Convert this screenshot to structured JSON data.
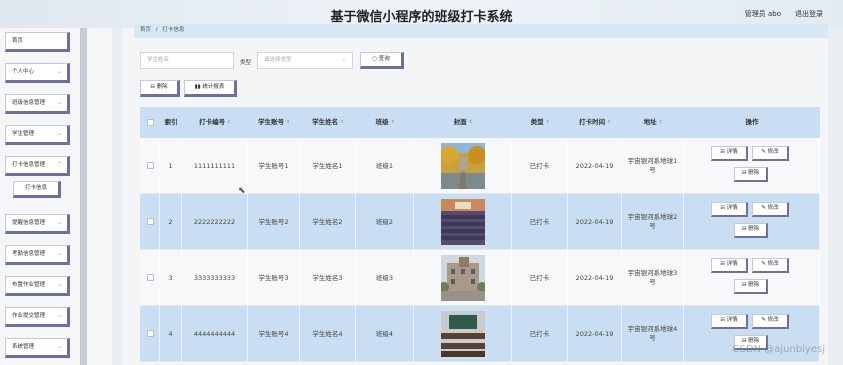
{
  "header": {
    "title": "基于微信小程序的班级打卡系统",
    "user": "管理员 abo",
    "logout": "退出登录"
  },
  "sidebar": {
    "items": [
      {
        "label": "首页",
        "has_chevron": false
      },
      {
        "label": "个人中心",
        "has_chevron": true
      },
      {
        "label": "班级信息管理",
        "has_chevron": true
      },
      {
        "label": "学生管理",
        "has_chevron": true
      },
      {
        "label": "打卡信息管理",
        "has_chevron": true
      },
      {
        "label": "打卡信息",
        "has_chevron": false,
        "sub": true
      },
      {
        "label": "提醒信息管理",
        "has_chevron": true
      },
      {
        "label": "考勤信息管理",
        "has_chevron": true
      },
      {
        "label": "布置作业管理",
        "has_chevron": true
      },
      {
        "label": "作业提交管理",
        "has_chevron": true
      },
      {
        "label": "系统管理",
        "has_chevron": true
      }
    ]
  },
  "breadcrumb": {
    "home": "首页",
    "separator": "/",
    "current": "打卡信息"
  },
  "search": {
    "placeholder": "学生姓名",
    "type_label": "类型",
    "type_placeholder": "请选择类型",
    "search_button": "查询",
    "delete_button": "删除",
    "stats_button": "统计报表"
  },
  "table": {
    "headers": [
      "",
      "索引",
      "打卡编号",
      "学生账号",
      "学生姓名",
      "班级",
      "封面",
      "类型",
      "打卡时间",
      "地址",
      "操作"
    ],
    "rows": [
      {
        "index": "1",
        "number": "1111111111",
        "account": "学生账号1",
        "name": "学生姓名1",
        "class": "班级1",
        "type": "已打卡",
        "time": "2022-04-19",
        "address": "宇宙银河系地球1号"
      },
      {
        "index": "2",
        "number": "2222222222",
        "account": "学生账号2",
        "name": "学生姓名2",
        "class": "班级2",
        "type": "已打卡",
        "time": "2022-04-19",
        "address": "宇宙银河系地球2号"
      },
      {
        "index": "3",
        "number": "3333333333",
        "account": "学生账号3",
        "name": "学生姓名3",
        "class": "班级3",
        "type": "已打卡",
        "time": "2022-04-19",
        "address": "宇宙银河系地球3号"
      },
      {
        "index": "4",
        "number": "4444444444",
        "account": "学生账号4",
        "name": "学生姓名4",
        "class": "班级4",
        "type": "已打卡",
        "time": "2022-04-19",
        "address": "宇宙银河系地球4号"
      }
    ],
    "actions": {
      "detail": "详情",
      "edit": "修改",
      "delete": "删除"
    }
  },
  "watermark": "CSDN @ajunbiyesj",
  "colors": {
    "accent": "#6e6f9e",
    "header_bg": "#c9def3",
    "breadcrumb_bg": "#d6e8f6"
  }
}
